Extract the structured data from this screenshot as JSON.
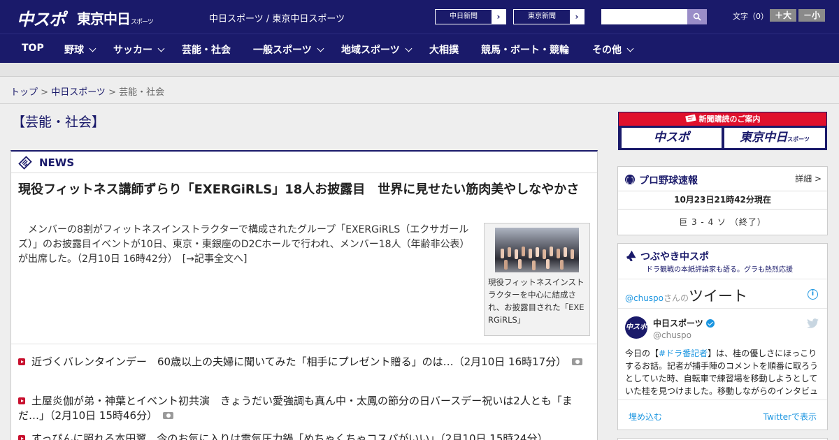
{
  "header": {
    "logo_chuspo": "中スポ",
    "logo_tokyo": "東京中日",
    "logo_tokyo_suffix": "スポーツ",
    "site_title": "中日スポーツ / 東京中日スポーツ",
    "ext_links": [
      {
        "label": "中日新聞"
      },
      {
        "label": "東京新聞"
      }
    ],
    "search_placeholder": "",
    "font_size_label": "文字（0）",
    "font_bigger": "＋大",
    "font_smaller": "－小"
  },
  "nav": {
    "items": [
      {
        "label": "TOP"
      },
      {
        "label": "野球"
      },
      {
        "label": "サッカー"
      },
      {
        "label": "芸能・社会"
      },
      {
        "label": "一般スポーツ"
      },
      {
        "label": "地域スポーツ"
      },
      {
        "label": "大相撲"
      },
      {
        "label": "競馬・ボート・競輪"
      },
      {
        "label": "その他"
      }
    ]
  },
  "breadcrumb": {
    "top": "トップ",
    "sep1": " > ",
    "chunichi": "中日スポーツ",
    "sep2": " > ",
    "current": "芸能・社会"
  },
  "page_title": "【芸能・社会】",
  "news": {
    "section_label": "NEWS",
    "headline": "現役フィットネス講師ずらり「EXERGiRLS」18人お披露目　世界に見せたい筋肉美やしなやかさ",
    "lead": "　メンバーの8割がフィットネスインストラクターで構成されたグループ「EXERGiRLS（エクサガールズ）」のお披露目イベントが10日、東京・東銀座のD2Cホールで行われ、メンバー18人（年齢非公表）が出席した。（2月10日 16時42分）　[→記事全文へ]",
    "photo_caption": "現役フィットネスインストラクターを中心に結成され、お披露目された「EXERGiRLS」",
    "list": [
      {
        "text": "近づくバレンタインデー　60歳以上の夫婦に聞いてみた「相手にプレゼント贈る」のは…（2月10日 16時17分）"
      },
      {
        "text": "土屋炎伽が弟・神葉とイベント初共演　きょうだい愛強調も真ん中・太鳳の節分の日バースデー祝いは2人とも「まだ…」（2月10日 15時46分）"
      },
      {
        "text": "すっぴんに照れる本田翼　今のお気に入りは電気圧力鍋「めちゃくちゃコスパがいい」（2月10日 15時24分）"
      }
    ]
  },
  "sidebar": {
    "banner_title": "新聞購読のご案内",
    "banner_chuspo": "中スポ",
    "banner_tokyo": "東京中日",
    "banner_tokyo_suffix": "スポーツ",
    "baseball": {
      "title": "プロ野球速報",
      "detail": "詳細 >",
      "timestamp": "10月23日21時42分現在",
      "score": "巨 3 - 4 ソ （終了）"
    },
    "tweets": {
      "title": "つぶやき中スポ",
      "subtitle": "ドラ観戦の本紙評論家も語る。グラも熱烈応援",
      "handle_prefix": "@chuspo",
      "handle_suffix": "さんの",
      "tweets_word": "ツイート",
      "account_name": "中日スポーツ",
      "account_handle": "@chuspo",
      "avatar_text": "中スポ",
      "tweet_pre": "今日の【",
      "tweet_tag": "#ドラ番記者",
      "tweet_post": "】は、桂の優しさにほっこりするお話。記者が捕手陣のコメントを順番に取ろうとしていた時、自転車で練習場を移動しようとしていた桂を見つけました。移動しながらのインタビュー",
      "embed_link": "埋め込む",
      "view_link": "Twitterで表示"
    }
  }
}
